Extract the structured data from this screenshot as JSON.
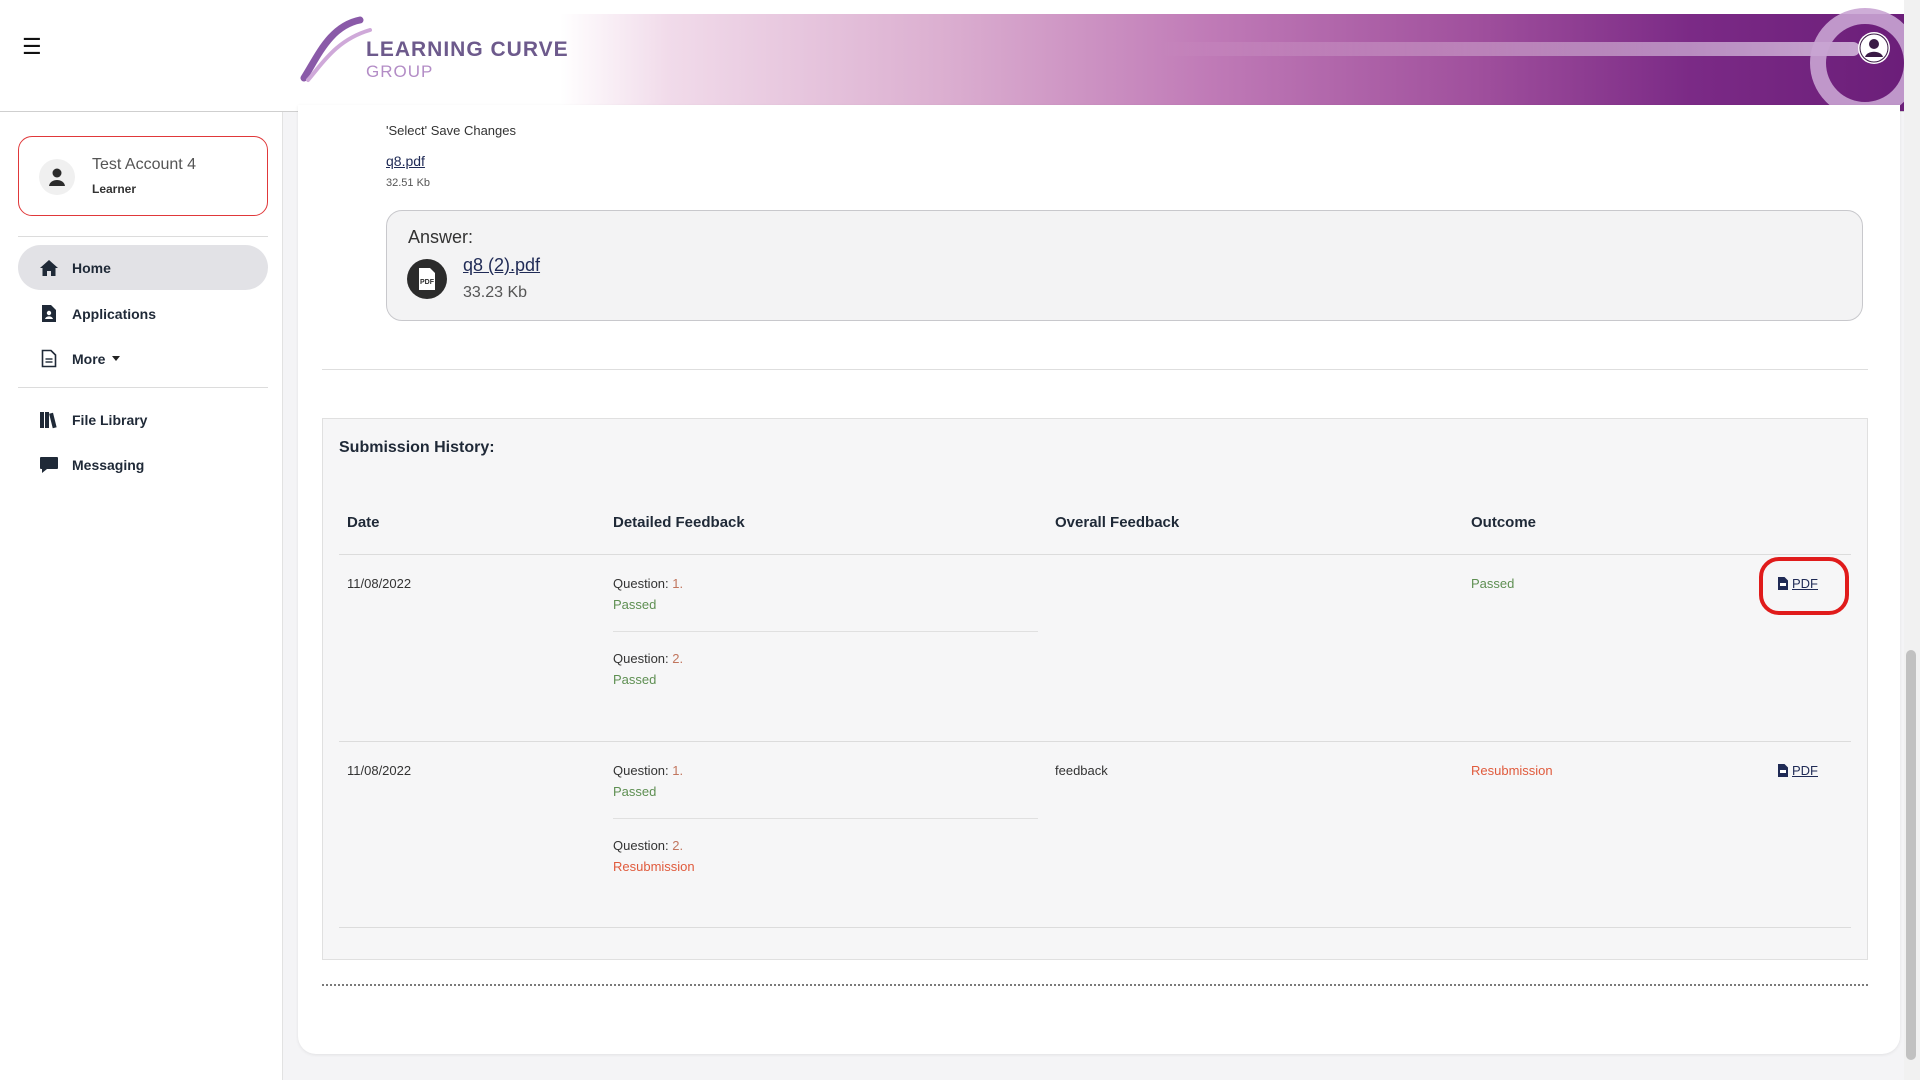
{
  "header": {
    "logo_line1": "LEARNING CURVE",
    "logo_line2": "GROUP",
    "menu_icon": "hamburger-icon",
    "profile_icon": "user-circle-icon"
  },
  "sidebar": {
    "user": {
      "name": "Test Account 4",
      "role": "Learner"
    },
    "items": [
      {
        "label": "Home",
        "icon": "home-icon",
        "active": true
      },
      {
        "label": "Applications",
        "icon": "document-person-icon"
      },
      {
        "label": "More",
        "icon": "document-icon"
      },
      {
        "label": "File Library",
        "icon": "books-icon"
      },
      {
        "label": "Messaging",
        "icon": "chat-icon"
      }
    ]
  },
  "question": {
    "note": "'Select' Save Changes",
    "file": {
      "name": "q8.pdf",
      "size": "32.51 Kb"
    },
    "answer": {
      "label": "Answer:",
      "file": "q8 (2).pdf",
      "size": "33.23 Kb"
    }
  },
  "history": {
    "title": "Submission History:",
    "columns": [
      "Date",
      "Detailed Feedback",
      "Overall Feedback",
      "Outcome"
    ],
    "question_label": "Question:",
    "rows": [
      {
        "date": "11/08/2022",
        "details": [
          {
            "number": "1.",
            "status": "Passed"
          },
          {
            "number": "2.",
            "status": "Passed"
          }
        ],
        "overall": "",
        "outcome": "Passed",
        "pdf": "PDF"
      },
      {
        "date": "11/08/2022",
        "details": [
          {
            "number": "1.",
            "status": "Passed"
          },
          {
            "number": "2.",
            "status": "Resubmission"
          }
        ],
        "overall": "feedback",
        "outcome": "Resubmission",
        "pdf": "PDF"
      }
    ]
  },
  "colors": {
    "brand_purple": "#6b1e79",
    "passed": "#5e8f52",
    "resubmission": "#e05b3d",
    "highlight": "#e01b1b"
  }
}
